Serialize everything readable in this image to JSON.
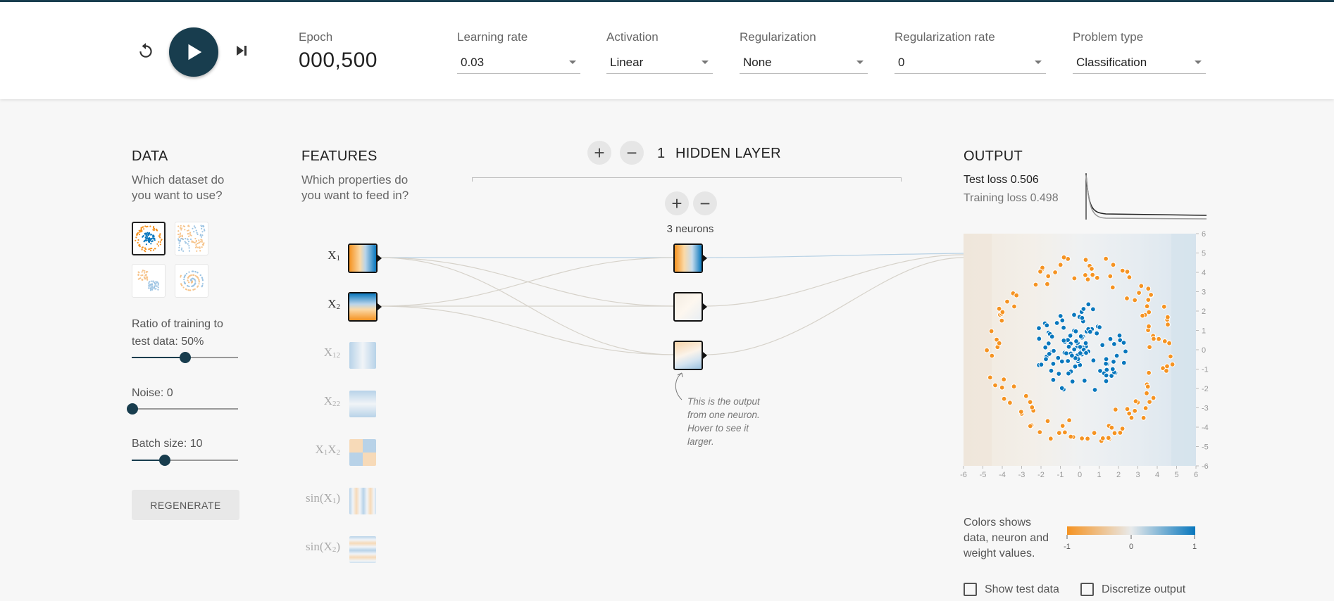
{
  "controls": {
    "reset_icon": "reset-icon",
    "play_icon": "play-icon",
    "step_icon": "step-forward-icon"
  },
  "epoch": {
    "label": "Epoch",
    "value": "000,500"
  },
  "settings": {
    "learning_rate": {
      "label": "Learning rate",
      "value": "0.03"
    },
    "activation": {
      "label": "Activation",
      "value": "Linear"
    },
    "regularization": {
      "label": "Regularization",
      "value": "None"
    },
    "regularization_rate": {
      "label": "Regularization rate",
      "value": "0"
    },
    "problem_type": {
      "label": "Problem type",
      "value": "Classification"
    }
  },
  "data": {
    "heading": "DATA",
    "question_line1": "Which dataset do",
    "question_line2": "you want to use?",
    "datasets": [
      "circle",
      "xor",
      "gaussian",
      "spiral"
    ],
    "selected_dataset": "circle",
    "ratio_label_line1": "Ratio of training to",
    "ratio_label_line2": "test data:  50%",
    "ratio_value": 50,
    "noise_label": "Noise:  0",
    "noise_value": 0,
    "batch_label": "Batch size:  10",
    "batch_value": 10,
    "regenerate_label": "REGENERATE"
  },
  "features": {
    "heading": "FEATURES",
    "question_line1": "Which properties do",
    "question_line2": "you want to feed in?",
    "items": [
      {
        "name": "X1",
        "base": "X",
        "sub": "1",
        "active": true
      },
      {
        "name": "X2",
        "base": "X",
        "sub": "2",
        "active": true
      },
      {
        "name": "X1^2",
        "base": "X",
        "sub": "12",
        "active": false
      },
      {
        "name": "X2^2",
        "base": "X",
        "sub": "22",
        "active": false
      },
      {
        "name": "X1X2",
        "base": "X1X2",
        "sub": "",
        "active": false
      },
      {
        "name": "sin(X1)",
        "base": "sin(X1)",
        "sub": "",
        "active": false
      },
      {
        "name": "sin(X2)",
        "base": "sin(X2)",
        "sub": "",
        "active": false
      }
    ]
  },
  "network": {
    "add_layer": "+",
    "remove_layer": "−",
    "layer_count": "1",
    "layer_heading": "HIDDEN LAYER",
    "add_neuron": "+",
    "remove_neuron": "−",
    "neurons_label": "3 neurons",
    "note_line1": "This is the output",
    "note_line2": "from one neuron.",
    "note_line3": "Hover to see it",
    "note_line4": "larger."
  },
  "output": {
    "heading": "OUTPUT",
    "test_loss_label": "Test loss",
    "test_loss_value": "0.506",
    "training_loss_label": "Training loss",
    "training_loss_value": "0.498",
    "x_ticks": [
      "-6",
      "-5",
      "-4",
      "-3",
      "-2",
      "-1",
      "0",
      "1",
      "2",
      "3",
      "4",
      "5",
      "6"
    ],
    "y_ticks": [
      "6",
      "5",
      "4",
      "3",
      "2",
      "1",
      "0",
      "-1",
      "-2",
      "-3",
      "-4",
      "-5",
      "-6"
    ],
    "legend_line1": "Colors shows",
    "legend_line2": "data, neuron and",
    "legend_line3": "weight values.",
    "legend_min": "-1",
    "legend_mid": "0",
    "legend_max": "1",
    "show_test_label": "Show test data",
    "discretize_label": "Discretize output"
  },
  "colors": {
    "orange": "#f59322",
    "blue": "#0877bd",
    "dark": "#183d4e"
  }
}
